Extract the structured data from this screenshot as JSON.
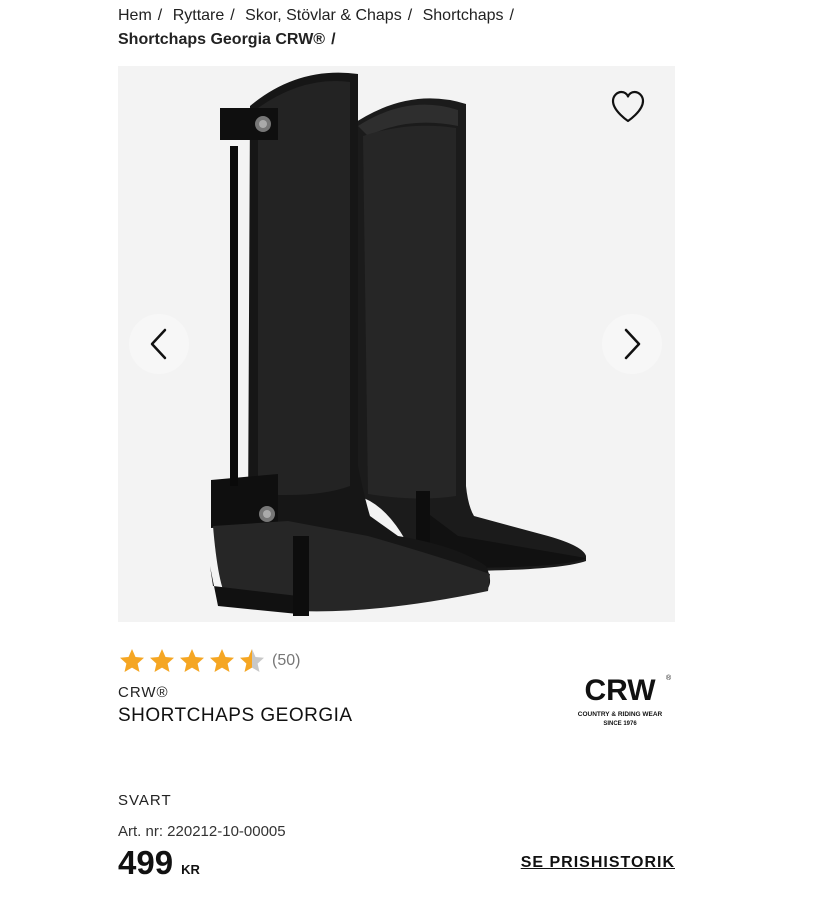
{
  "breadcrumb": {
    "items": [
      "Hem",
      "Ryttare",
      "Skor, Stövlar & Chaps",
      "Shortchaps"
    ],
    "current": "Shortchaps Georgia CRW®",
    "separator": "/"
  },
  "gallery": {
    "favorite_icon": "heart-outline-icon",
    "prev_icon": "chevron-left-icon",
    "next_icon": "chevron-right-icon"
  },
  "rating": {
    "value": 4.5,
    "max": 5,
    "count_label": "(50)",
    "star_color": "#f5a623",
    "empty_color": "#c8c8c8"
  },
  "product": {
    "brand": "CRW®",
    "name": "SHORTCHAPS GEORGIA",
    "color": "SVART",
    "art_nr": "Art. nr: 220212-10-00005",
    "price": "499",
    "currency": "KR",
    "price_history_link": "SE PRISHISTORIK"
  },
  "brand_logo": {
    "text": "CRW",
    "registered": "®",
    "tagline": "COUNTRY & RIDING WEAR",
    "since": "SINCE 1976"
  }
}
